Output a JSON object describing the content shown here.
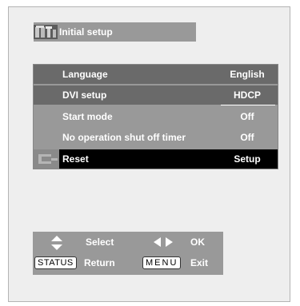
{
  "header": {
    "title": "Initial setup",
    "icon": "setup-menu-icon"
  },
  "menu": {
    "items": [
      {
        "label": "Language",
        "value": "English"
      },
      {
        "label": "DVI setup",
        "value": "HDCP"
      },
      {
        "label": "Start mode",
        "value": "Off"
      },
      {
        "label": "No operation shut off timer",
        "value": "Off"
      },
      {
        "label": "Reset",
        "value": "Setup",
        "icon": "reset-icon"
      }
    ]
  },
  "footer": {
    "select_label": "Select",
    "ok_label": "OK",
    "status_key": "STATUS",
    "return_label": "Return",
    "menu_key": "MENU",
    "exit_label": "Exit"
  },
  "colors": {
    "background": "#eeeeee",
    "panel": "#999999",
    "row_dark": "#6a6a6a",
    "selected": "#000000",
    "text": "#ffffff"
  }
}
